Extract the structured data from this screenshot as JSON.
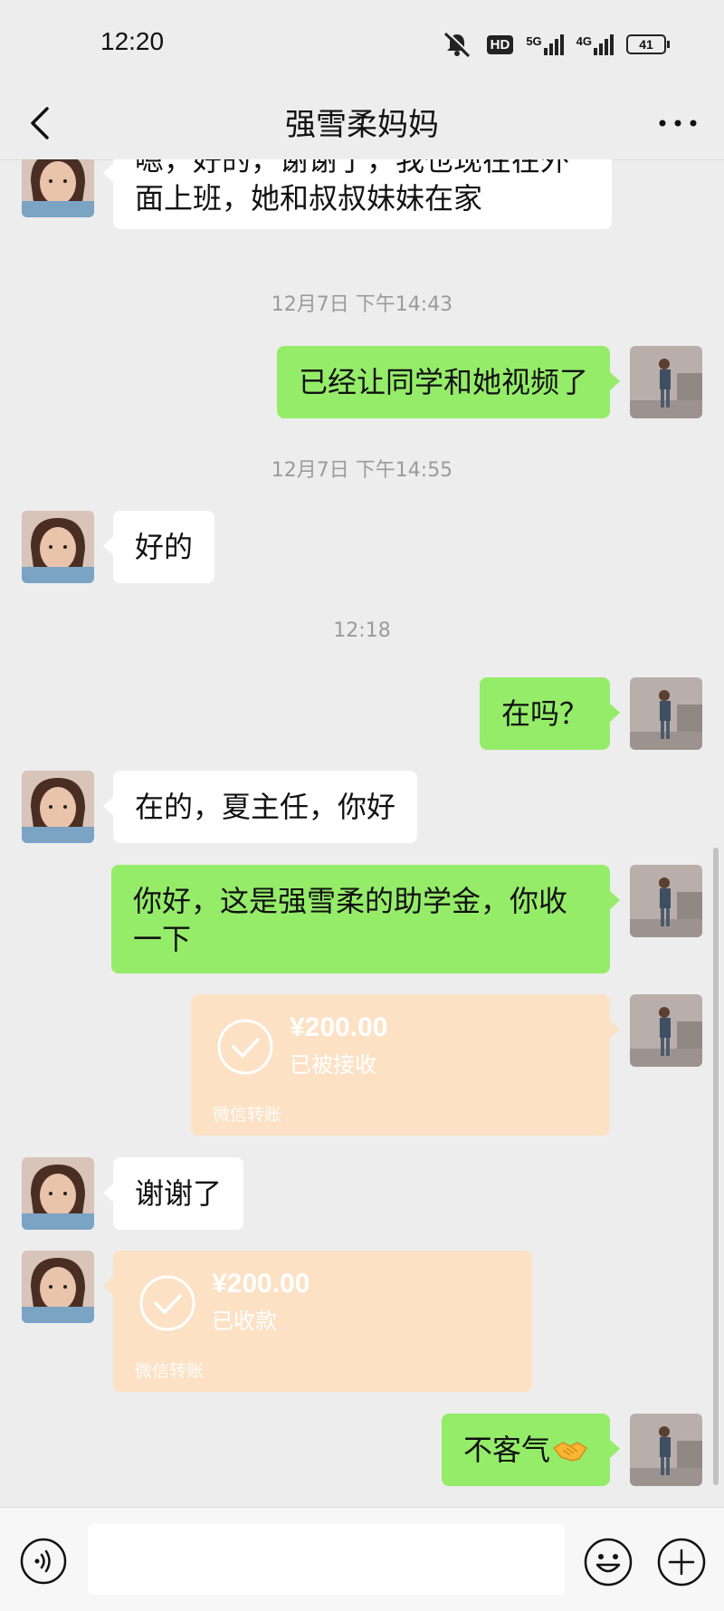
{
  "status_bar": {
    "time": "12:20",
    "hd": "HD",
    "net1": "5G",
    "net2": "4G",
    "battery": "41"
  },
  "nav": {
    "title": "强雪柔妈妈"
  },
  "messages": {
    "m1": "嗯，好的，谢谢了，我也现在在外面上班，她和叔叔妹妹在家",
    "ts1": "12月7日 下午14:43",
    "m2": "已经让同学和她视频了",
    "ts2": "12月7日 下午14:55",
    "m3": "好的",
    "ts3": "12:18",
    "m4": "在吗？",
    "m5": "在的，夏主任，你好",
    "m6": "你好，这是强雪柔的助学金，你收一下",
    "transfer1": {
      "amount": "¥200.00",
      "status": "已被接收",
      "label": "微信转账"
    },
    "m7": "谢谢了",
    "transfer2": {
      "amount": "¥200.00",
      "status": "已收款",
      "label": "微信转账"
    },
    "m8": "不客气",
    "m8_icon": "handshake-emoji"
  },
  "input": {
    "placeholder": ""
  },
  "colors": {
    "background": "#ededed",
    "my_bubble": "#95ec69",
    "their_bubble": "#ffffff",
    "transfer_card": "#fce1c4"
  }
}
